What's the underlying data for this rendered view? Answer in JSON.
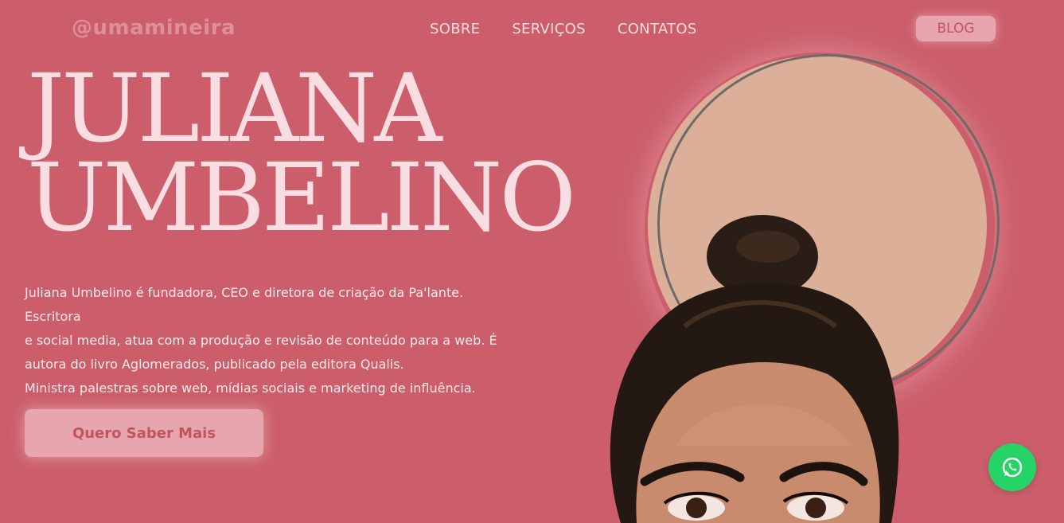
{
  "header": {
    "logo": "@umamineira",
    "nav": [
      {
        "label": "SOBRE"
      },
      {
        "label": "SERVIÇOS"
      },
      {
        "label": "CONTATOS"
      }
    ],
    "blog_label": "BLOG"
  },
  "hero": {
    "title_line1": "JULIANA",
    "title_line2": "UMBELINO",
    "bio_line1": "Juliana Umbelino é fundadora, CEO e diretora de criação da Pa'lante. Escritora",
    "bio_line2": "e social media, atua com a produção e revisão de conteúdo para a web. É",
    "bio_line3": "autora do livro Aglomerados, publicado pela editora Qualis.",
    "bio_line4": "Ministra palestras sobre web, mídias sociais e marketing de influência.",
    "cta_label": "Quero Saber Mais"
  },
  "widgets": {
    "whatsapp_icon": "whatsapp-icon"
  },
  "colors": {
    "background": "#cb5e6a",
    "button_bg": "#e7a6ad",
    "button_text": "#c0545f",
    "circle": "#dcaf98",
    "whatsapp": "#25d366"
  }
}
